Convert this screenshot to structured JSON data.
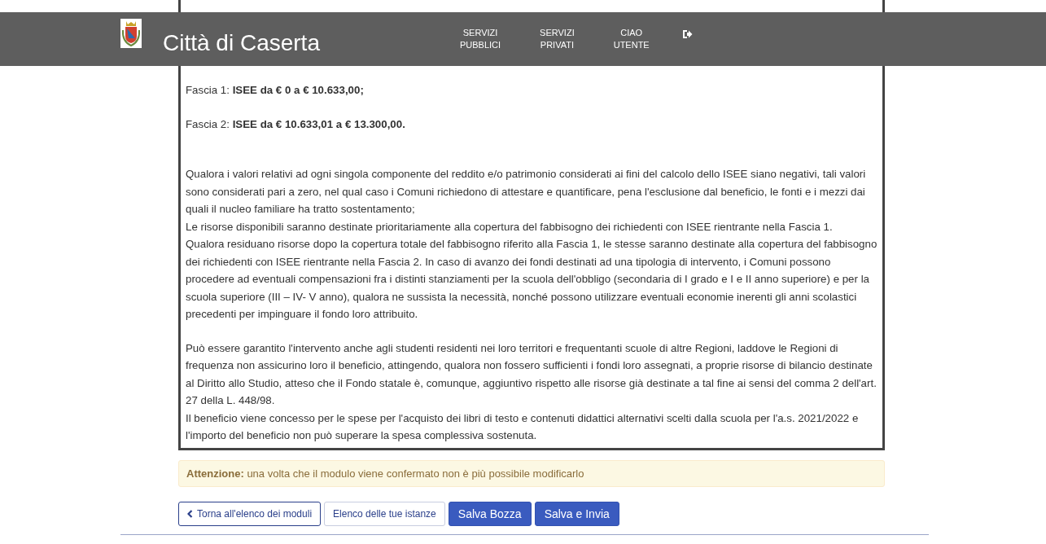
{
  "header": {
    "title": "Città di Caserta",
    "nav": [
      {
        "label": "SERVIZI PUBBLICI"
      },
      {
        "label": "SERVIZI PRIVATI"
      },
      {
        "label": "CIAO UTENTE"
      }
    ]
  },
  "document": {
    "sections": [
      [
        "Fascia 1: **ISEE da € 0 a € 10.633,00;**"
      ],
      [
        "Fascia 2: **ISEE da € 10.633,01 a € 13.300,00.**"
      ],
      [
        "Qualora i valori relativi ad ogni singola componente del reddito e/o patrimonio considerati ai fini del calcolo dello ISEE siano negativi, tali valori sono considerati pari a zero, nel qual caso i Comuni richiedono di attestare e quantificare, pena l'esclusione dal beneficio, le fonti e i mezzi dai quali il nucleo familiare ha tratto sostentamento;",
        "Le risorse disponibili saranno destinate prioritariamente alla copertura del fabbisogno dei richiedenti con ISEE rientrante nella Fascia 1.",
        "Qualora residuano risorse dopo la copertura totale del fabbisogno riferito alla Fascia 1, le stesse saranno destinate alla copertura del fabbisogno dei richiedenti con ISEE rientrante nella Fascia 2. In caso di avanzo dei fondi destinati ad una tipologia di intervento, i Comuni possono procedere ad eventuali compensazioni fra i distinti stanziamenti per la scuola dell'obbligo (secondaria di I grado e I e II anno superiore) e per la scuola superiore (III – IV- V anno), qualora ne sussista la necessità, nonché possono utilizzare eventuali economie inerenti gli anni scolastici precedenti per impinguare il fondo loro attribuito."
      ],
      [
        "Può essere garantito l'intervento anche agli studenti residenti nei loro territori e frequentanti scuole di altre Regioni, laddove le Regioni di frequenza non assicurino loro il beneficio, attingendo, qualora non fossero sufficienti i fondi loro assegnati, a proprie risorse di bilancio destinate al Diritto allo Studio, atteso che il Fondo statale è, comunque, aggiuntivo rispetto alle risorse già destinate a tal fine ai sensi del comma 2 dell'art. 27 della L. 448/98.",
        "Il beneficio viene concesso per le spese per l'acquisto dei libri di testo e contenuti didattici alternativi scelti dalla scuola per l'a.s. 2021/2022 e l'importo del beneficio non può superare la spesa complessiva sostenuta."
      ]
    ]
  },
  "alert": "**Attenzione:** una volta che il modulo viene confermato non è più possibile modificarlo",
  "buttons": [
    {
      "label": "Torna all'elenco dei moduli",
      "kind": "back"
    },
    {
      "label": "Elenco delle tue istanze",
      "kind": "outline"
    },
    {
      "label": "Salva Bozza",
      "kind": "primary"
    },
    {
      "label": "Salva e Invia",
      "kind": "primary"
    }
  ]
}
